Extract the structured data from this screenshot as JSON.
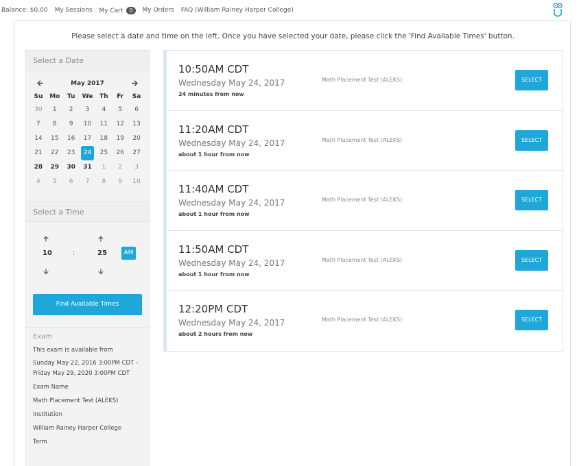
{
  "topnav": {
    "balance": "Balance: $0.00",
    "my_sessions": "My Sessions",
    "my_cart": "My Cart",
    "cart_count": "0",
    "my_orders": "My Orders",
    "faq": "FAQ (William Rainey Harper College)"
  },
  "instructions": "Please select a date and time on the left. Once you have selected your date, please click the 'Find Available Times' button.",
  "date_panel": {
    "title": "Select a Date",
    "month_label": "May 2017",
    "weekdays": [
      "Su",
      "Mo",
      "Tu",
      "We",
      "Th",
      "Fr",
      "Sa"
    ],
    "weeks": [
      [
        "30",
        "1",
        "2",
        "3",
        "4",
        "5",
        "6"
      ],
      [
        "7",
        "8",
        "9",
        "10",
        "11",
        "12",
        "13"
      ],
      [
        "14",
        "15",
        "16",
        "17",
        "18",
        "19",
        "20"
      ],
      [
        "21",
        "22",
        "23",
        "24",
        "25",
        "26",
        "27"
      ],
      [
        "28",
        "29",
        "30",
        "31",
        "1",
        "2",
        "3"
      ],
      [
        "4",
        "5",
        "6",
        "7",
        "8",
        "9",
        "10"
      ]
    ],
    "selected_day": "24"
  },
  "time_panel": {
    "title": "Select a Time",
    "hour": "10",
    "separator": ":",
    "minute": "25",
    "ampm": "AM"
  },
  "find_button": "Find Available Times",
  "exam_info": {
    "title": "Exam",
    "available_label": "This exam is available from",
    "available_range": "Sunday May 22, 2016 3:00PM CDT - Friday May 29, 2020 3:00PM CDT",
    "exam_name_label": "Exam Name",
    "exam_name": "Math Placement Test (ALEKS)",
    "institution_label": "Institution",
    "institution": "William Rainey Harper College",
    "term_label": "Term"
  },
  "slots": [
    {
      "time": "10:50AM CDT",
      "date": "Wednesday May 24, 2017",
      "relative": "24 minutes from now",
      "exam": "Math Placement Test (ALEKS)",
      "button": "SELECT"
    },
    {
      "time": "11:20AM CDT",
      "date": "Wednesday May 24, 2017",
      "relative": "about 1 hour from now",
      "exam": "Math Placement Test (ALEKS)",
      "button": "SELECT"
    },
    {
      "time": "11:40AM CDT",
      "date": "Wednesday May 24, 2017",
      "relative": "about 1 hour from now",
      "exam": "Math Placement Test (ALEKS)",
      "button": "SELECT"
    },
    {
      "time": "11:50AM CDT",
      "date": "Wednesday May 24, 2017",
      "relative": "about 1 hour from now",
      "exam": "Math Placement Test (ALEKS)",
      "button": "SELECT"
    },
    {
      "time": "12:20PM CDT",
      "date": "Wednesday May 24, 2017",
      "relative": "about 2 hours from now",
      "exam": "Math Placement Test (ALEKS)",
      "button": "SELECT"
    }
  ],
  "colors": {
    "accent": "#1fa7da"
  },
  "icons": {
    "prev_month": "arrow-left-icon",
    "next_month": "arrow-right-icon",
    "up": "arrow-up-icon",
    "down": "arrow-down-icon",
    "logo": "owl-logo-icon"
  }
}
